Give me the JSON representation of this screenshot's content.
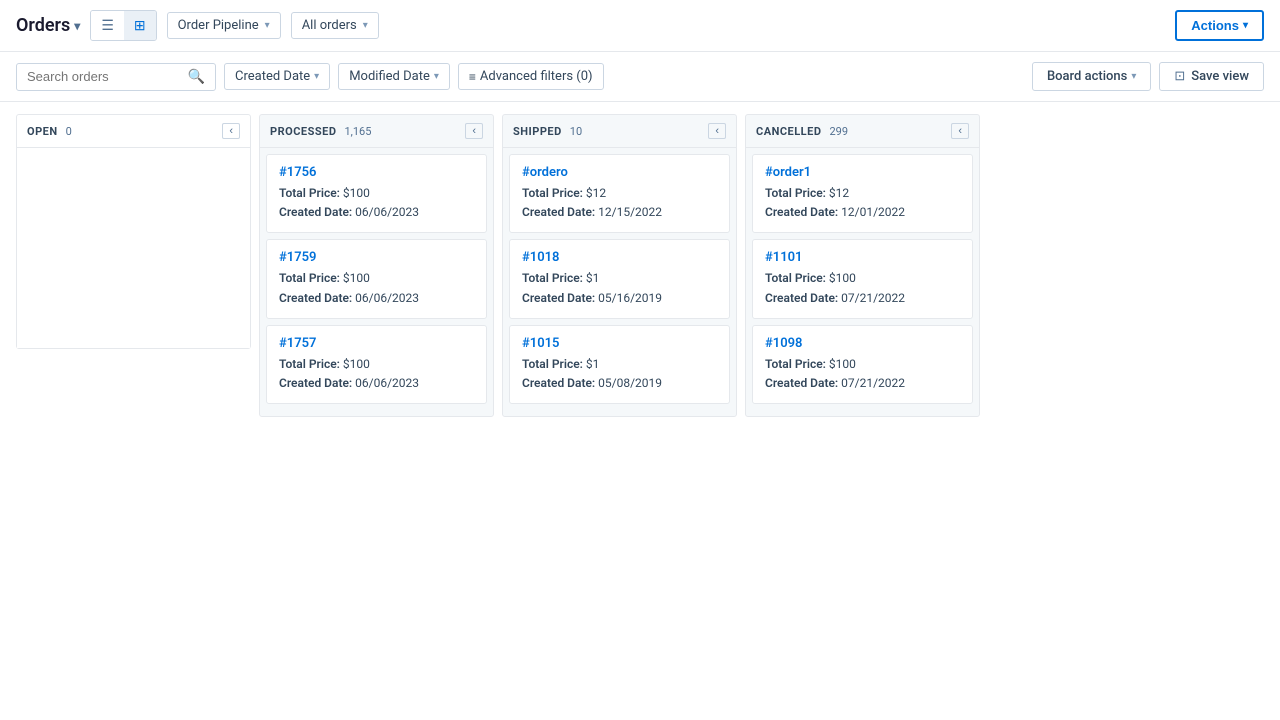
{
  "title": "Orders",
  "topbar": {
    "orders_label": "Orders",
    "chevron": "▾",
    "view_pipeline_label": "Order Pipeline",
    "view_pipeline_arrow": "▾",
    "all_orders_label": "All orders",
    "all_orders_arrow": "▾",
    "actions_label": "Actions",
    "actions_arrow": "▾"
  },
  "filterbar": {
    "search_placeholder": "Search orders",
    "created_date_label": "Created Date",
    "created_date_arrow": "▾",
    "modified_date_label": "Modified Date",
    "modified_date_arrow": "▾",
    "advanced_filters_label": "Advanced filters (0)",
    "board_actions_label": "Board actions",
    "board_actions_arrow": "▾",
    "save_view_icon": "⊡",
    "save_view_label": "Save view"
  },
  "columns": [
    {
      "id": "open",
      "title": "OPEN",
      "count": "0",
      "cards": []
    },
    {
      "id": "processed",
      "title": "PROCESSED",
      "count": "1,165",
      "cards": [
        {
          "id": "#1756",
          "total_price": "$100",
          "created_date": "06/06/2023"
        },
        {
          "id": "#1759",
          "total_price": "$100",
          "created_date": "06/06/2023"
        },
        {
          "id": "#1757",
          "total_price": "$100",
          "created_date": "06/06/2023"
        }
      ]
    },
    {
      "id": "shipped",
      "title": "SHIPPED",
      "count": "10",
      "cards": [
        {
          "id": "#ordero",
          "total_price": "$12",
          "created_date": "12/15/2022"
        },
        {
          "id": "#1018",
          "total_price": "$1",
          "created_date": "05/16/2019"
        },
        {
          "id": "#1015",
          "total_price": "$1",
          "created_date": "05/08/2019"
        }
      ]
    },
    {
      "id": "cancelled",
      "title": "CANCELLED",
      "count": "299",
      "cards": [
        {
          "id": "#order1",
          "total_price": "$12",
          "created_date": "12/01/2022"
        },
        {
          "id": "#1101",
          "total_price": "$100",
          "created_date": "07/21/2022"
        },
        {
          "id": "#1098",
          "total_price": "$100",
          "created_date": "07/21/2022"
        }
      ]
    }
  ],
  "labels": {
    "total_price": "Total Price:",
    "created_date": "Created Date:",
    "collapse": "‹"
  }
}
